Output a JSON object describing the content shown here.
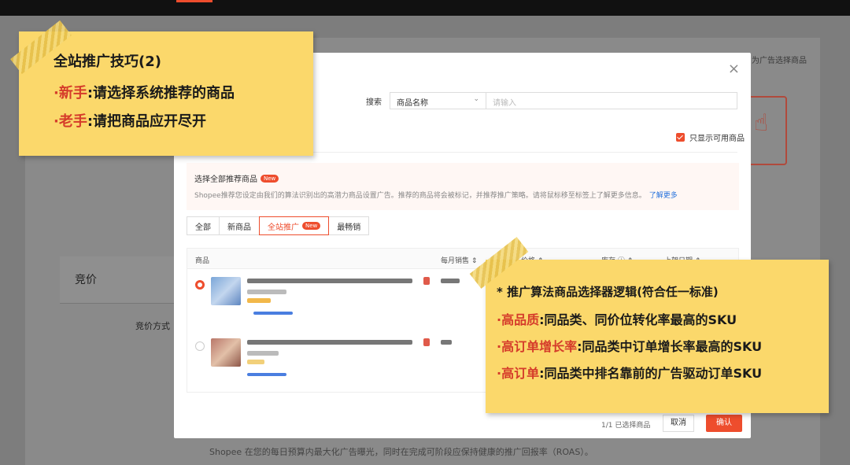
{
  "background": {
    "hint_text": "为广告选择商品",
    "bid_section_title": "竞价",
    "bid_mode_label": "竞价方式",
    "footer_text": "Shopee 在您的每日预算内最大化广告曝光，同时在完成可阶段应保持健康的推广回报率（ROAS）。"
  },
  "modal": {
    "close_icon": "×",
    "search": {
      "label": "搜索",
      "select_value": "商品名称",
      "input_placeholder": "请输入"
    },
    "only_available_label": "只显示可用商品",
    "recommend": {
      "title": "选择全部推荐商品",
      "badge": "New",
      "description": "Shopee推荐您设定由我们的算法识别出的高潜力商品设置广告。推荐的商品将会被标记，并推荐推广策略。请将鼠标移至标签上了解更多信息。",
      "link": "了解更多"
    },
    "tabs": [
      {
        "label": "全部"
      },
      {
        "label": "新商品"
      },
      {
        "label": "全站推广",
        "badge": "New"
      },
      {
        "label": "最畅销"
      }
    ],
    "table": {
      "headers": [
        "商品",
        "每月销售 ⇕",
        "价格 ⇕",
        "库存 ⓘ ⇕",
        "上架日期 ⇕"
      ]
    },
    "footer": {
      "count": "1/1 已选择商品",
      "cancel": "取消",
      "confirm": "确认"
    }
  },
  "note1": {
    "title": "全站推广技巧(2)",
    "line1_prefix": "·新手",
    "line1_text": ":请选择系统推荐的商品",
    "line2_prefix": "·老手",
    "line2_text": ":请把商品应开尽开"
  },
  "note2": {
    "title": "* 推广算法商品选择器逻辑(符合任一标准)",
    "l1_prefix": "·高品质",
    "l1_text": ":同品类、同价位转化率最高的SKU",
    "l2_prefix": "·高订单增长率",
    "l2_text": ":同品类中订单增长率最高的SKU",
    "l3_prefix": "·高订单",
    "l3_text": ":同品类中排名靠前的广告驱动订单SKU"
  }
}
